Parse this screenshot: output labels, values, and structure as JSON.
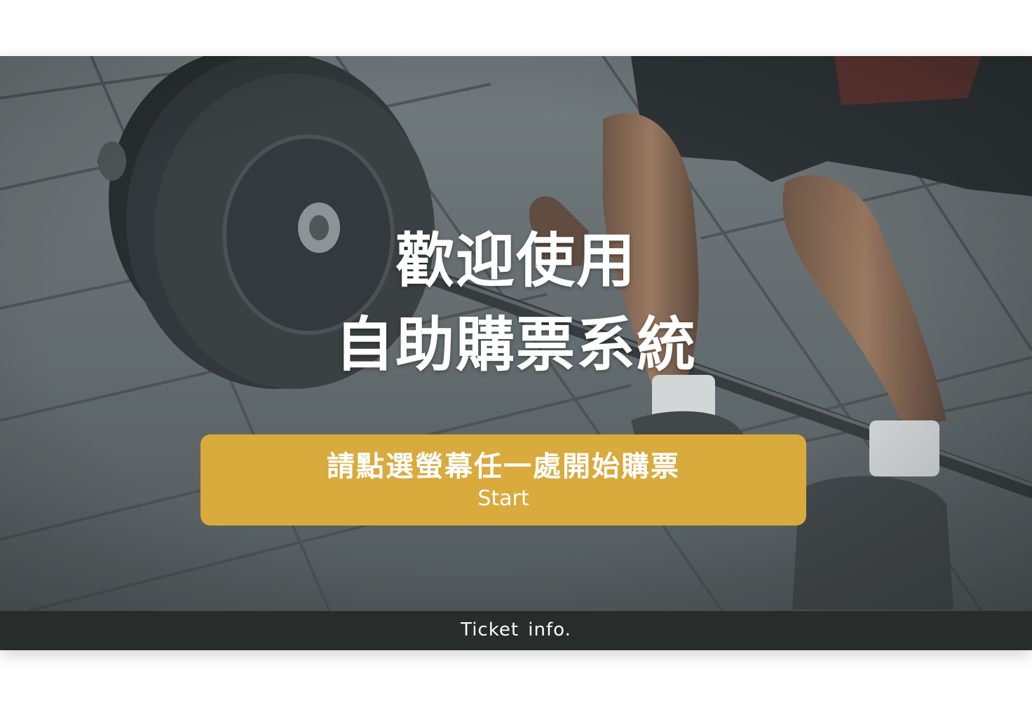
{
  "hero": {
    "title_line1": "歡迎使用",
    "title_line2": "自助購票系統",
    "background_icon": "barbell-deadlift-photo"
  },
  "start": {
    "label_zh": "請點選螢幕任一處開始購票",
    "label_en": "Start"
  },
  "footer": {
    "link_label": "Ticket info."
  },
  "colors": {
    "accent": "#d9aa3c",
    "footer_bg": "#282d2c",
    "text": "#ffffff"
  }
}
